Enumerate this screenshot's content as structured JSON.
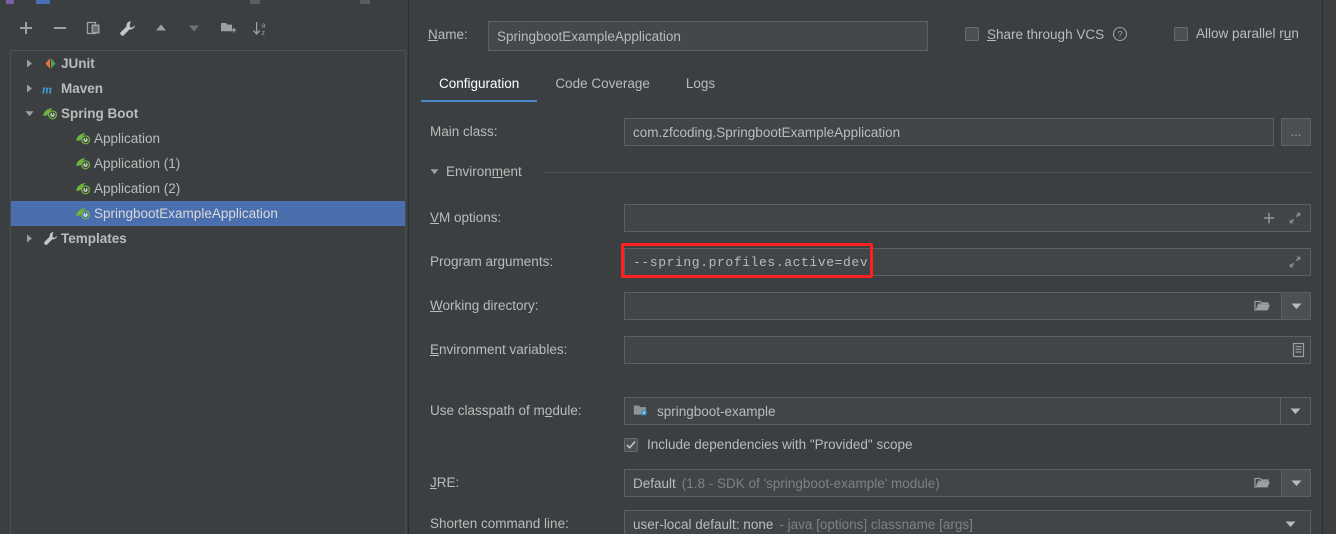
{
  "window": {
    "bg": "#3c3f41",
    "accent": "#4a88c7",
    "selection": "#4b6eaf",
    "highlight_red": "#ff1f1f"
  },
  "toolbar": {
    "buttons": [
      {
        "name": "add-button",
        "icon": "plus-icon",
        "label": "+"
      },
      {
        "name": "remove-button",
        "icon": "minus-icon",
        "label": "−"
      },
      {
        "name": "copy-configuration-button",
        "icon": "copy-icon",
        "label": "Copy Configuration"
      },
      {
        "name": "edit-templates-button",
        "icon": "wrench-icon",
        "label": "Edit Templates"
      },
      {
        "name": "move-up-button",
        "icon": "arrow-up-icon",
        "label": "Move Up"
      },
      {
        "name": "move-down-button",
        "icon": "arrow-down-icon",
        "label": "Move Down"
      },
      {
        "name": "create-folder-button",
        "icon": "folder-add-icon",
        "label": "Create New Folder"
      },
      {
        "name": "sort-configurations-button",
        "icon": "sort-az-icon",
        "label": "Sort Configurations"
      }
    ]
  },
  "tree": {
    "items": [
      {
        "label": "JUnit",
        "icon": "junit-icon",
        "expanded": false,
        "depth": 0,
        "bold": true,
        "selected": false,
        "has_twisty": true
      },
      {
        "label": "Maven",
        "icon": "maven-icon",
        "expanded": false,
        "depth": 0,
        "bold": true,
        "selected": false,
        "has_twisty": true
      },
      {
        "label": "Spring Boot",
        "icon": "spring-boot-icon",
        "expanded": true,
        "depth": 0,
        "bold": true,
        "selected": false,
        "has_twisty": true
      },
      {
        "label": "Application",
        "icon": "spring-boot-icon",
        "expanded": false,
        "depth": 1,
        "bold": false,
        "selected": false,
        "has_twisty": false
      },
      {
        "label": "Application (1)",
        "icon": "spring-boot-icon",
        "expanded": false,
        "depth": 1,
        "bold": false,
        "selected": false,
        "has_twisty": false
      },
      {
        "label": "Application (2)",
        "icon": "spring-boot-icon",
        "expanded": false,
        "depth": 1,
        "bold": false,
        "selected": false,
        "has_twisty": false
      },
      {
        "label": "SpringbootExampleApplication",
        "icon": "spring-boot-icon",
        "expanded": false,
        "depth": 1,
        "bold": false,
        "selected": true,
        "has_twisty": false
      },
      {
        "label": "Templates",
        "icon": "wrench-icon",
        "expanded": false,
        "depth": 0,
        "bold": true,
        "selected": false,
        "has_twisty": true
      }
    ]
  },
  "header": {
    "name_label": "Name:",
    "name_label_mnemonic": "N",
    "name_value": "SpringbootExampleApplication",
    "share_vcs_label": "Share through VCS",
    "share_vcs_mnemonic": "S",
    "share_vcs_checked": false,
    "help_icon_tooltip": "?",
    "allow_parallel_label": "Allow parallel run",
    "allow_parallel_checked": false
  },
  "tabs": [
    {
      "label": "Configuration",
      "active": true
    },
    {
      "label": "Code Coverage",
      "active": false
    },
    {
      "label": "Logs",
      "active": false
    }
  ],
  "form": {
    "main_class": {
      "label": "Main class:",
      "value": "com.zfcoding.SpringbootExampleApplication",
      "browse_button_label": "..."
    },
    "environment_section": {
      "label": "Environment",
      "mnemonic": "m",
      "expanded": true
    },
    "vm_options": {
      "label": "VM options:",
      "mnemonic": "V",
      "value": "",
      "macros_icon": "plus-icon",
      "expand_icon": "expand-icon"
    },
    "program_arguments": {
      "label": "Program arguments:",
      "mnemonic": "g",
      "value": "--spring.profiles.active=dev",
      "expand_icon": "expand-icon",
      "highlighted": true
    },
    "working_directory": {
      "label": "Working directory:",
      "mnemonic": "W",
      "value": "",
      "browse_icon": "folder-icon",
      "dropdown_icon": "chevron-down-icon"
    },
    "environment_variables": {
      "label": "Environment variables:",
      "mnemonic": "E",
      "value": "",
      "edit_icon": "list-icon"
    },
    "use_classpath_of_module": {
      "label": "Use classpath of module:",
      "mnemonic": "o",
      "value": "springboot-example",
      "icon": "module-icon",
      "dropdown_icon": "chevron-down-icon"
    },
    "include_provided": {
      "label": "Include dependencies with \"Provided\" scope",
      "checked": true
    },
    "jre": {
      "label": "JRE:",
      "mnemonic": "J",
      "value": "Default",
      "value_hint": "(1.8 - SDK of 'springboot-example' module)",
      "browse_icon": "folder-icon",
      "dropdown_icon": "chevron-down-icon"
    },
    "shorten_command_line": {
      "label": "Shorten command line:",
      "value": "user-local default: none",
      "value_hint": "- java [options] classname [args]",
      "dropdown_icon": "chevron-down-icon"
    }
  }
}
